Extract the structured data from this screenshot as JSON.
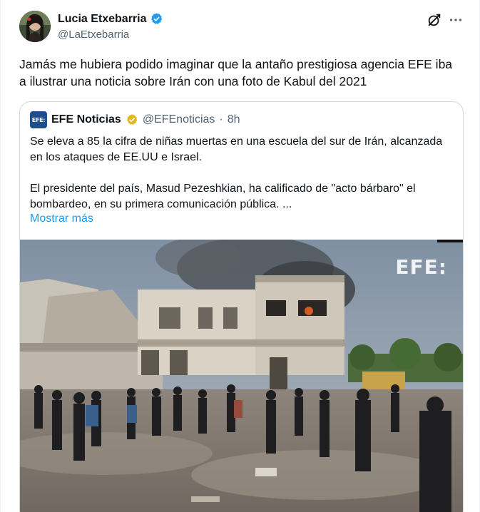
{
  "tweet": {
    "author": {
      "display_name": "Lucia Etxebarria",
      "handle": "@LaEtxebarria",
      "verified_badge": "verified-blue-icon",
      "badge_color": "#1d9bf0"
    },
    "text": "Jamás me hubiera podido imaginar que la antaño prestigiosa agencia EFE iba a ilustrar una noticia sobre Irán con una foto de Kabul del 2021",
    "actions": {
      "grok_icon": "grok-icon",
      "more_icon": "more-icon"
    }
  },
  "quoted": {
    "author": {
      "display_name": "EFE Noticias",
      "handle": "@EFEnoticias",
      "separator": "·",
      "time": "8h",
      "logo_text": "EFE:",
      "logo_color": "#1d4f8f",
      "badge_color": "#e2b719"
    },
    "paragraph_1": "Se eleva a 85 la cifra de niñas muertas en una escuela del sur de Irán, alcanzada en los ataques de EE.UU e Israel.",
    "paragraph_2": "El presidente del país, Masud Pezeshkian, ha calificado de \"acto bárbaro\" el bombardeo, en su primera comunicación pública. ...",
    "show_more": "Mostrar más",
    "media": {
      "watermark": "EFE:"
    }
  },
  "colors": {
    "link": "#1d9bf0",
    "secondary_text": "#536471",
    "border": "#cfd9de"
  }
}
